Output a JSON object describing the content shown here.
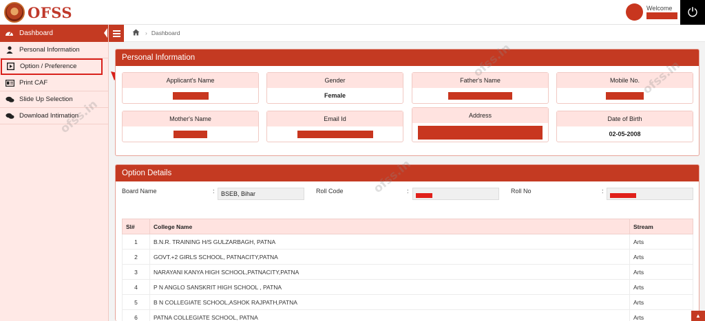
{
  "brand": {
    "logo_text": "OFSS"
  },
  "header": {
    "welcome": "Welcome"
  },
  "sidebar": {
    "dashboard": "Dashboard",
    "items": [
      {
        "label": "Personal Information",
        "icon": "user-icon"
      },
      {
        "label": "Option / Preference",
        "icon": "play-square-icon"
      },
      {
        "label": "Print CAF",
        "icon": "id-card-icon"
      },
      {
        "label": "Slide Up Selection",
        "icon": "comments-icon"
      },
      {
        "label": "Download Intimation",
        "icon": "comments-icon"
      }
    ]
  },
  "breadcrumb": {
    "current": "Dashboard"
  },
  "personal": {
    "title": "Personal Information",
    "applicant_name_label": "Applicant's Name",
    "gender_label": "Gender",
    "gender_value": "Female",
    "father_name_label": "Father's Name",
    "mobile_label": "Mobile No.",
    "mother_name_label": "Mother's Name",
    "email_label": "Email Id",
    "address_label": "Address",
    "dob_label": "Date of Birth",
    "dob_value": "02-05-2008"
  },
  "options": {
    "title": "Option Details",
    "board_label": "Board Name",
    "board_value": "BSEB, Bihar",
    "roll_code_label": "Roll Code",
    "roll_no_label": "Roll No",
    "colon": ":",
    "columns": [
      "Sl#",
      "College Name",
      "Stream"
    ],
    "rows": [
      {
        "sl": "1",
        "college": "B.N.R. TRAINING H/S GULZARBAGH, PATNA",
        "stream": "Arts"
      },
      {
        "sl": "2",
        "college": "GOVT.+2 GIRLS SCHOOL, PATNACITY,PATNA",
        "stream": "Arts"
      },
      {
        "sl": "3",
        "college": "NARAYANI KANYA HIGH SCHOOL,PATNACITY,PATNA",
        "stream": "Arts"
      },
      {
        "sl": "4",
        "college": "P N ANGLO SANSKRIT HIGH SCHOOL , PATNA",
        "stream": "Arts"
      },
      {
        "sl": "5",
        "college": "B N COLLEGIATE SCHOOL,ASHOK RAJPATH,PATNA",
        "stream": "Arts"
      },
      {
        "sl": "6",
        "college": "PATNA COLLEGIATE SCHOOL, PATNA",
        "stream": "Arts"
      }
    ]
  },
  "watermark": "ofss.in",
  "colors": {
    "primary": "#c43a22",
    "sidebar_bg": "#ffe9e6",
    "card_label_bg": "#ffe3e0",
    "redaction": "#c8361f"
  }
}
